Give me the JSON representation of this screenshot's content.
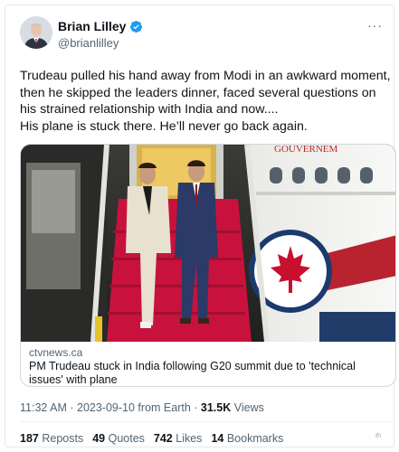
{
  "author": {
    "name": "Brian Lilley",
    "handle": "@brianlilley",
    "verified_color": "#1d9bf0"
  },
  "more_icon": "more-horizontal-icon",
  "tweet": {
    "text": "Trudeau pulled his hand away from Modi in an awkward moment, then he skipped the leaders dinner, faced several questions on his strained relationship with India and now....\nHis plane is stuck there. He’ll never go back again."
  },
  "link_card": {
    "domain": "ctvnews.ca",
    "title": "PM Trudeau stuck in India following G20 summit due to 'technical issues' with plane",
    "photo_plane_text": "GOUVERNEM"
  },
  "meta": {
    "time": "11:32 AM",
    "sep": " · ",
    "date": "2023-09-10",
    "source": " from Earth",
    "views_count": "31.5K",
    "views_label": "Views"
  },
  "stats": {
    "reposts_count": "187",
    "reposts_label": "Reposts",
    "quotes_count": "49",
    "quotes_label": "Quotes",
    "likes_count": "742",
    "likes_label": "Likes",
    "bookmarks_count": "14",
    "bookmarks_label": "Bookmarks"
  },
  "corner_mark": "th"
}
